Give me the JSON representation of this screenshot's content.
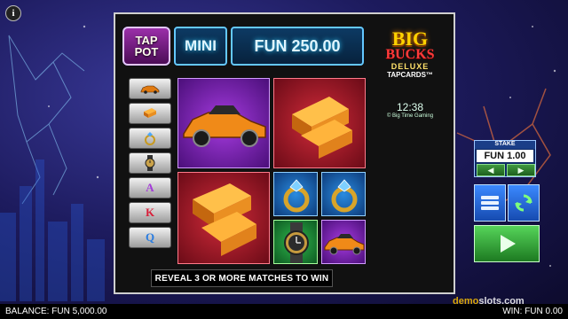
{
  "jackpot": {
    "tap_pot_line1": "TAP",
    "tap_pot_line2": "POT",
    "tier": "MINI",
    "amount": "FUN 250.00"
  },
  "paytable": {
    "symbols": [
      {
        "icon": "car-icon",
        "label": ""
      },
      {
        "icon": "gold-bar-icon",
        "label": ""
      },
      {
        "icon": "ring-icon",
        "label": ""
      },
      {
        "icon": "watch-icon",
        "label": ""
      },
      {
        "icon": "card-ace",
        "label": "A"
      },
      {
        "icon": "card-king",
        "label": "K"
      },
      {
        "icon": "card-queen",
        "label": "Q"
      }
    ]
  },
  "grid": {
    "tiles": [
      {
        "symbol": "car-icon",
        "color": "purple"
      },
      {
        "symbol": "gold-bar-icon",
        "color": "red"
      },
      {
        "symbol": "gold-bar-icon",
        "color": "red"
      },
      {
        "symbol": "ring-icon",
        "color": "blue"
      },
      {
        "symbol": "ring-icon",
        "color": "blue"
      },
      {
        "symbol": "watch-icon",
        "color": "green"
      },
      {
        "symbol": "car-icon",
        "color": "purple"
      }
    ]
  },
  "message": "REVEAL 3 OR MORE MATCHES TO WIN",
  "logo": {
    "line1": "BIG",
    "line2": "BUCKS",
    "line3": "DELUXE",
    "line4": "TAPCARDS™"
  },
  "clock": "12:38",
  "copyright": "© Big Time Gaming",
  "stake": {
    "label": "STAKE",
    "value": "FUN 1.00"
  },
  "status": {
    "balance": "BALANCE: FUN 5,000.00",
    "win": "WIN: FUN 0.00"
  },
  "watermark": {
    "part1": "demo",
    "part2": "slots.com"
  },
  "info_icon_label": "i",
  "colors": {
    "jackpot_border": "#64c8ff",
    "spin_green": "#56d45a",
    "menu_blue": "#3b89ff"
  }
}
